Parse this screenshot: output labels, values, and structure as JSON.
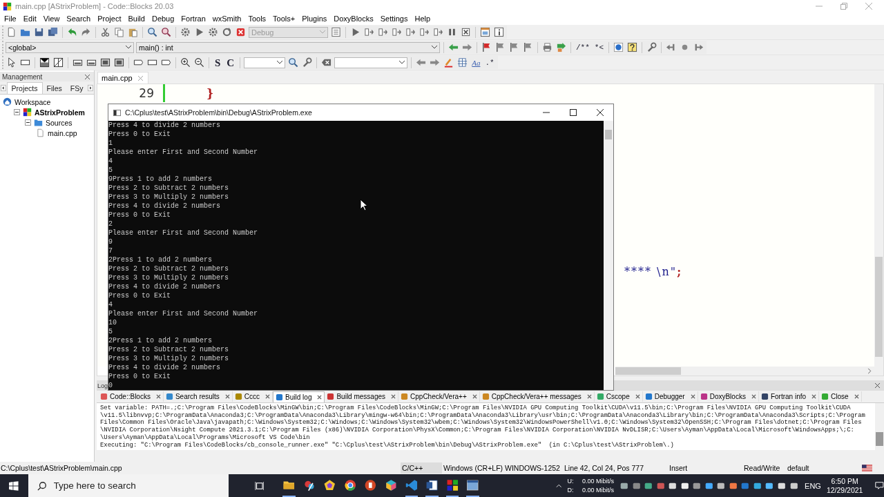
{
  "window": {
    "title": "main.cpp [AStrixProblem] - Code::Blocks 20.03"
  },
  "menu": [
    "File",
    "Edit",
    "View",
    "Search",
    "Project",
    "Build",
    "Debug",
    "Fortran",
    "wxSmith",
    "Tools",
    "Tools+",
    "Plugins",
    "DoxyBlocks",
    "Settings",
    "Help"
  ],
  "toolbar": {
    "build_target": "Debug",
    "scope": "<global>",
    "function": "main() : int",
    "text_buttons": [
      "S",
      "C"
    ],
    "comment_buttons": [
      "/**",
      "*<"
    ],
    "case_button": "Aa",
    "regex_button": ".*"
  },
  "management": {
    "title": "Management",
    "tabs": [
      {
        "label": "Projects",
        "selected": true
      },
      {
        "label": "Files",
        "selected": false
      },
      {
        "label": "FSy",
        "selected": false
      }
    ],
    "tree": [
      {
        "label": "Workspace",
        "kind": "workspace",
        "children": [
          {
            "label": "AStrixProblem",
            "kind": "project",
            "expanded": true,
            "children": [
              {
                "label": "Sources",
                "kind": "folder",
                "expanded": true,
                "children": [
                  {
                    "label": "main.cpp",
                    "kind": "file"
                  }
                ]
              }
            ]
          }
        ]
      }
    ]
  },
  "editor": {
    "tabs": [
      {
        "label": "main.cpp",
        "selected": true
      }
    ],
    "lines": [
      {
        "number": "29",
        "fragments": [
          {
            "kind": "operator",
            "text": "}"
          }
        ]
      },
      {
        "fragments": [
          {
            "kind": "string",
            "text": "**** \\n\""
          },
          {
            "kind": "operator",
            "text": ";"
          }
        ]
      }
    ]
  },
  "console": {
    "title": "C:\\Cplus\\test\\AStrixProblem\\bin\\Debug\\AStrixProblem.exe",
    "lines": [
      "Press 4 to divide 2 numbers",
      "Press 0 to Exit",
      "1",
      "Please enter First and Second Number",
      "4",
      "5",
      "9Press 1 to add 2 numbers",
      "Press 2 to Subtract 2 numbers",
      "Press 3 to Multiply 2 numbers",
      "Press 4 to divide 2 numbers",
      "Press 0 to Exit",
      "2",
      "Please enter First and Second Number",
      "9",
      "7",
      "2Press 1 to add 2 numbers",
      "Press 2 to Subtract 2 numbers",
      "Press 3 to Multiply 2 numbers",
      "Press 4 to divide 2 numbers",
      "Press 0 to Exit",
      "4",
      "Please enter First and Second Number",
      "10",
      "5",
      "2Press 1 to add 2 numbers",
      "Press 2 to Subtract 2 numbers",
      "Press 3 to Multiply 2 numbers",
      "Press 4 to divide 2 numbers",
      "Press 0 to Exit",
      "0"
    ]
  },
  "logs": {
    "title": "Log",
    "tabs": [
      {
        "label": "Code::Blocks",
        "selected": false
      },
      {
        "label": "Search results",
        "selected": false
      },
      {
        "label": "Cccc",
        "selected": false
      },
      {
        "label": "Build log",
        "selected": true
      },
      {
        "label": "Build messages",
        "selected": false
      },
      {
        "label": "CppCheck/Vera++",
        "selected": false
      },
      {
        "label": "CppCheck/Vera++ messages",
        "selected": false
      },
      {
        "label": "Cscope",
        "selected": false
      },
      {
        "label": "Debugger",
        "selected": false
      },
      {
        "label": "DoxyBlocks",
        "selected": false
      },
      {
        "label": "Fortran info",
        "selected": false
      },
      {
        "label": "Close",
        "selected": false
      }
    ],
    "lines": [
      "Set variable: PATH=.;C:\\Program Files\\CodeBlocks\\MinGW\\bin;C:\\Program Files\\CodeBlocks\\MinGW;C:\\Program Files\\NVIDIA GPU Computing Toolkit\\CUDA\\v11.5\\bin;C:\\Program Files\\NVIDIA GPU Computing Toolkit\\CUDA",
      "\\v11.5\\libnvvp;C:\\ProgramData\\Anaconda3;C:\\ProgramData\\Anaconda3\\Library\\mingw-w64\\bin;C:\\ProgramData\\Anaconda3\\Library\\usr\\bin;C:\\ProgramData\\Anaconda3\\Library\\bin;C:\\ProgramData\\Anaconda3\\Scripts;C:\\Program",
      "Files\\Common Files\\Oracle\\Java\\javapath;C:\\Windows\\System32;C:\\Windows;C:\\Windows\\System32\\wbem;C:\\Windows\\System32\\WindowsPowerShell\\v1.0;C:\\Windows\\System32\\OpenSSH;C:\\Program Files\\dotnet;C:\\Program Files",
      "\\NVIDIA Corporation\\Nsight Compute 2021.3.1;C:\\Program Files (x86)\\NVIDIA Corporation\\PhysX\\Common;C:\\Program Files\\NVIDIA Corporation\\NVIDIA NvDLISR;C:\\Users\\Ayman\\AppData\\Local\\Microsoft\\WindowsApps;\\;C:",
      "\\Users\\Ayman\\AppData\\Local\\Programs\\Microsoft VS Code\\bin",
      "Executing: \"C:\\Program Files\\CodeBlocks/cb_console_runner.exe\" \"C:\\Cplus\\test\\AStrixProblem\\bin\\Debug\\AStrixProblem.exe\"  (in C:\\Cplus\\test\\AStrixProblem\\.)"
    ]
  },
  "status_bar": [
    "C:\\Cplus\\test\\AStrixProblem\\main.cpp",
    "C/C++",
    "Windows (CR+LF)",
    "WINDOWS-1252",
    "Line 42, Col 24, Pos 777",
    "Insert",
    "Read/Write",
    "default"
  ],
  "taskbar": {
    "search_placeholder": "Type here to search",
    "network": [
      {
        "label": "U:",
        "rate": "0.00 Mibit/s"
      },
      {
        "label": "D:",
        "rate": "0.00 Mibit/s"
      }
    ],
    "language": "ENG",
    "time": "6:50 PM",
    "date": "12/29/2021"
  }
}
